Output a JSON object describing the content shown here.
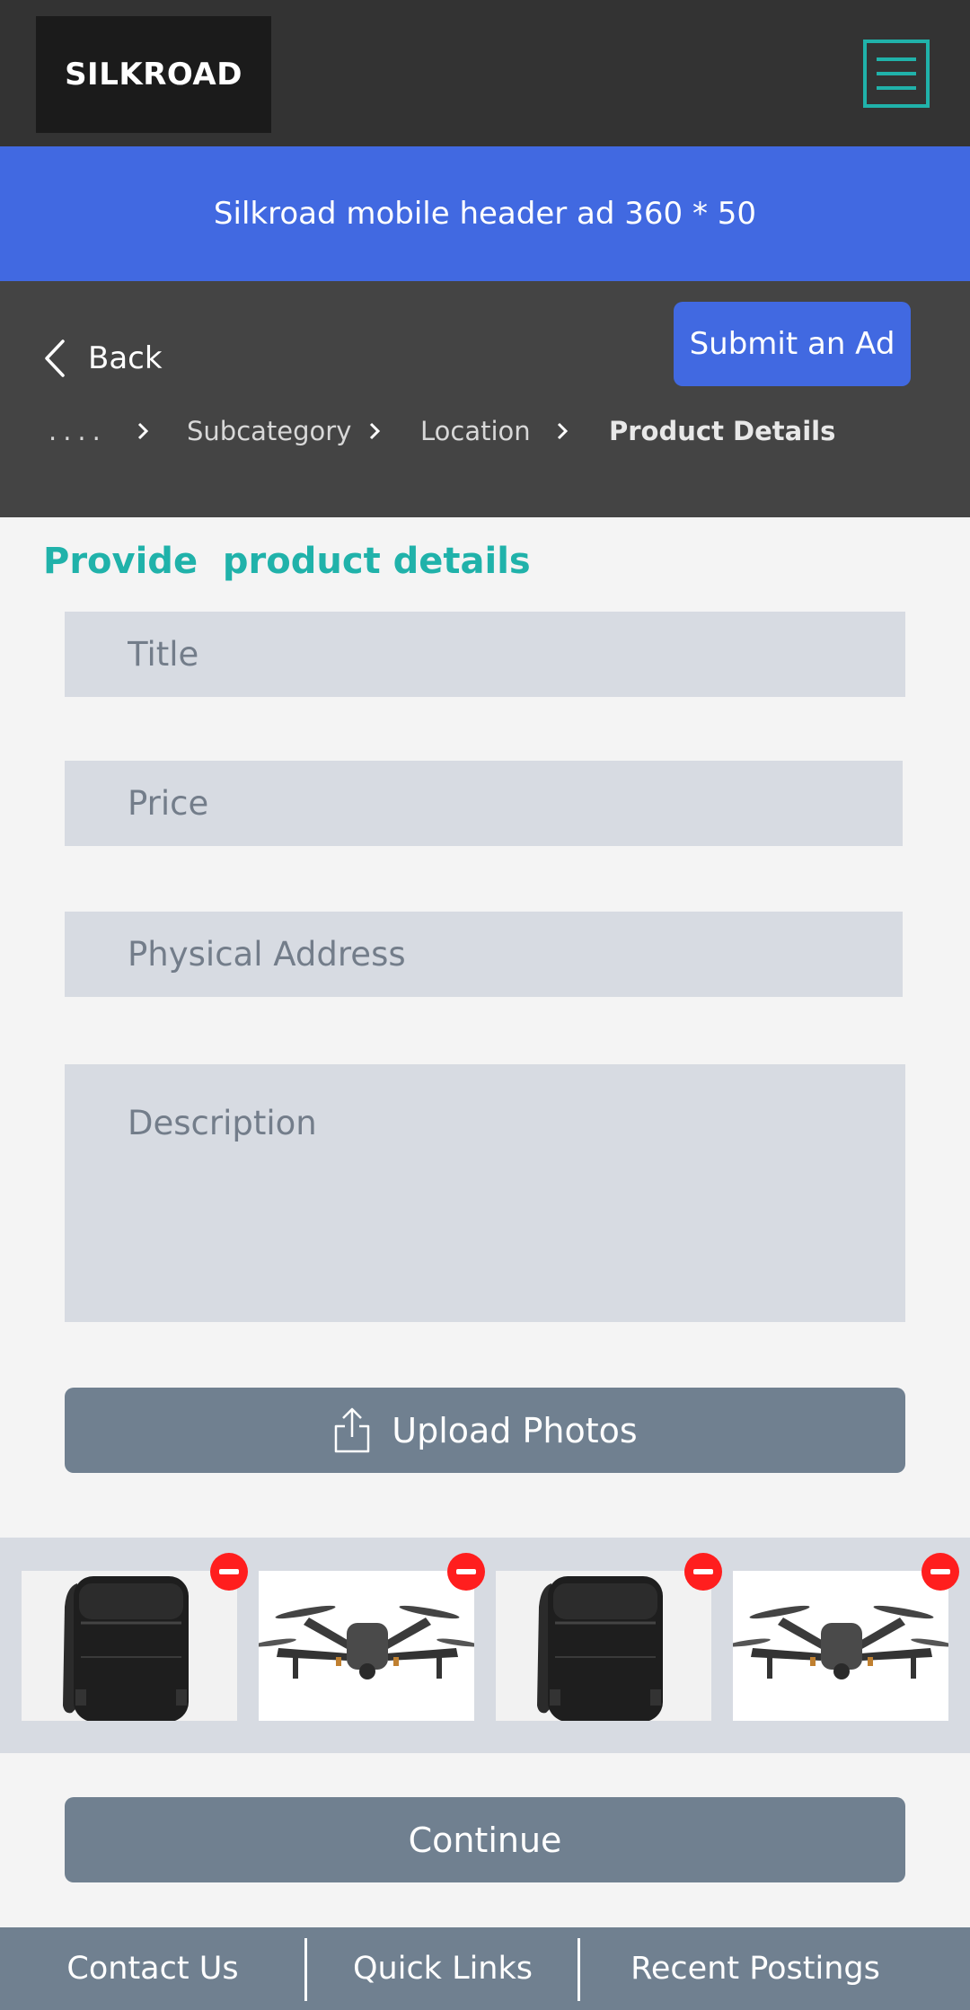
{
  "header": {
    "logo_text": "SILKROAD",
    "menu_icon": "hamburger-menu-icon",
    "accent_color": "#20b2aa"
  },
  "ad_banner": {
    "text": "Silkroad mobile header ad 360 * 50",
    "color": "#4169e1"
  },
  "nav": {
    "back_label": "Back",
    "submit_label": "Submit an Ad",
    "breadcrumbs": [
      "....",
      "Subcategory",
      "Location",
      "Product Details"
    ]
  },
  "form": {
    "title": "Provide  product details",
    "title_placeholder": "Title",
    "price_placeholder": "Price",
    "address_placeholder": "Physical Address",
    "description_placeholder": "Description",
    "upload_label": "Upload Photos",
    "continue_label": "Continue"
  },
  "photos": [
    {
      "subject": "backpack"
    },
    {
      "subject": "drone"
    },
    {
      "subject": "backpack"
    },
    {
      "subject": "drone"
    }
  ],
  "footer": {
    "links": [
      "Contact Us",
      "Quick Links",
      "Recent Postings"
    ]
  }
}
